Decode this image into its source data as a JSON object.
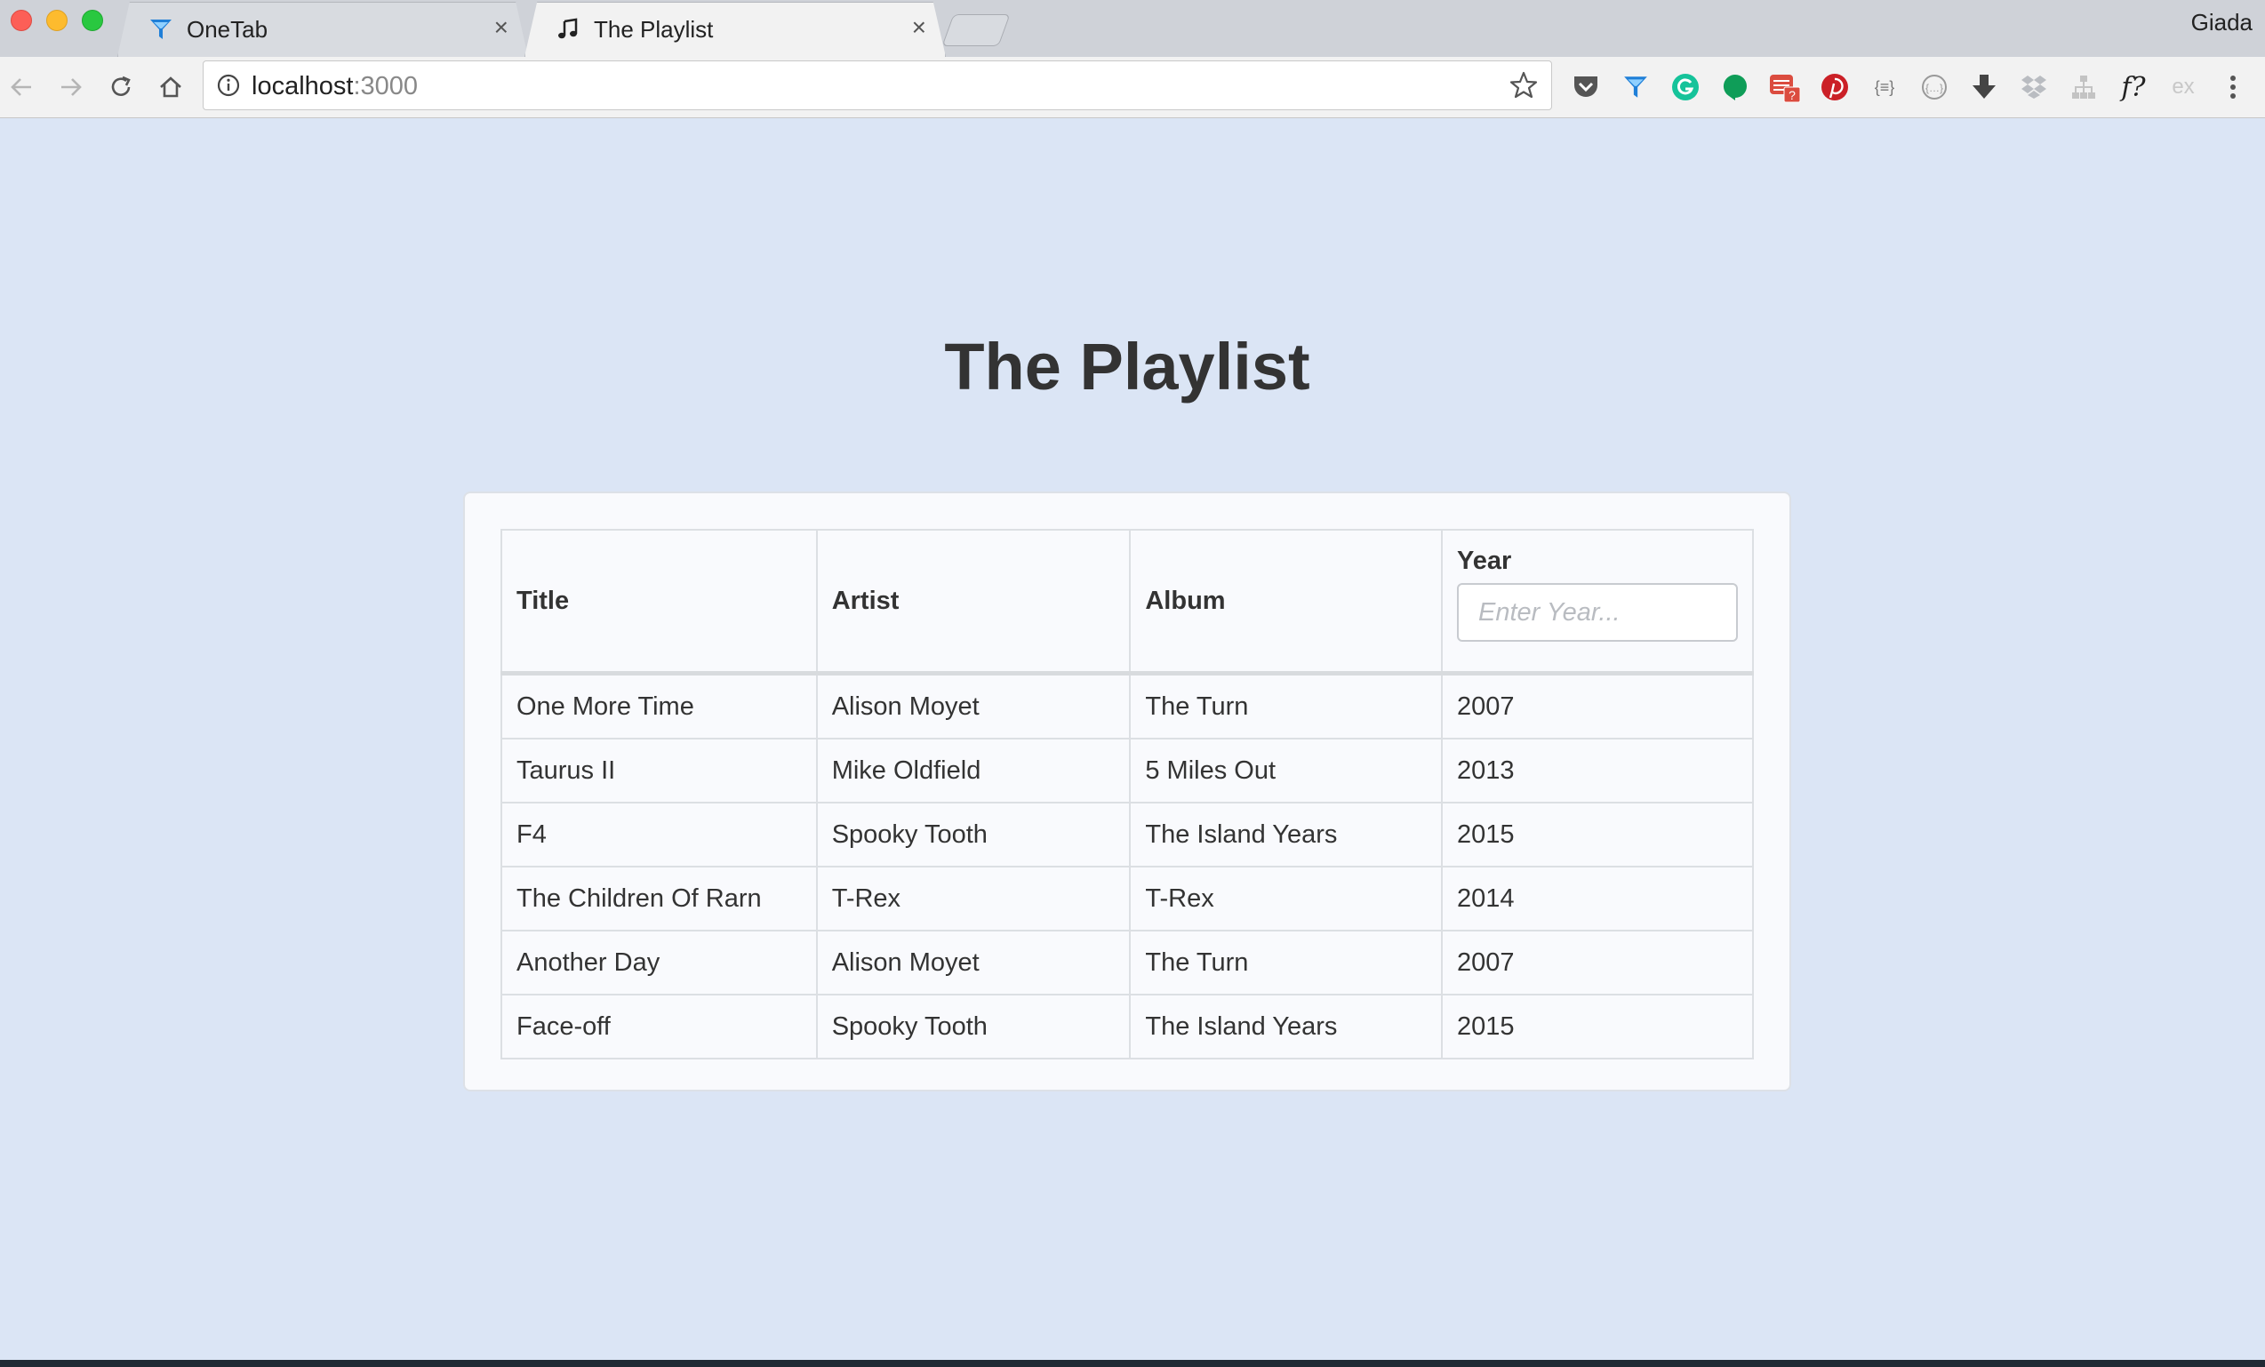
{
  "browser": {
    "tabs": [
      {
        "label": "OneTab",
        "icon": "onetab-funnel-icon",
        "active": false
      },
      {
        "label": "The Playlist",
        "icon": "music-note-icon",
        "active": true
      }
    ],
    "close_glyph": "×",
    "profile_name": "Giada",
    "address": {
      "host": "localhost",
      "port": ":3000"
    },
    "extensions": [
      "pocket-icon",
      "onetab-icon",
      "grammarly-icon",
      "hangouts-icon",
      "todoist-icon",
      "pinterest-icon",
      "json-viewer-icon",
      "placeholder-icon",
      "download-icon",
      "dropbox-icon",
      "sitemap-icon",
      "fontface-icon",
      "extension-ex-icon",
      "menu-dots-icon"
    ],
    "ext_font_label": "f?",
    "ext_ex_label": "ex",
    "ext_json_label": "{≡}"
  },
  "page": {
    "title": "The Playlist",
    "colors": {
      "background": "#dbe5f5",
      "text": "#333333"
    }
  },
  "table": {
    "headers": {
      "title": "Title",
      "artist": "Artist",
      "album": "Album",
      "year": "Year"
    },
    "year_filter": {
      "placeholder": "Enter Year...",
      "value": ""
    },
    "rows": [
      {
        "title": "One More Time",
        "artist": "Alison Moyet",
        "album": "The Turn",
        "year": "2007"
      },
      {
        "title": "Taurus II",
        "artist": "Mike Oldfield",
        "album": "5 Miles Out",
        "year": "2013"
      },
      {
        "title": "F4",
        "artist": "Spooky Tooth",
        "album": "The Island Years",
        "year": "2015"
      },
      {
        "title": "The Children Of Rarn",
        "artist": "T-Rex",
        "album": "T-Rex",
        "year": "2014"
      },
      {
        "title": "Another Day",
        "artist": "Alison Moyet",
        "album": "The Turn",
        "year": "2007"
      },
      {
        "title": "Face-off",
        "artist": "Spooky Tooth",
        "album": "The Island Years",
        "year": "2015"
      }
    ]
  }
}
